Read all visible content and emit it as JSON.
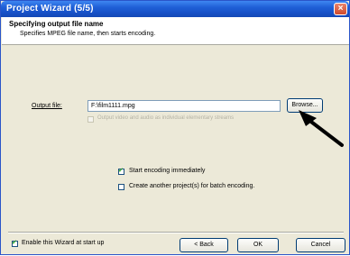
{
  "window": {
    "title": "Project Wizard (5/5)",
    "close_glyph": "×"
  },
  "header": {
    "title": "Specifying output file name",
    "subtitle": "Specifies MPEG file name, then starts encoding."
  },
  "output": {
    "label": "Output file:",
    "value": "F:\\film1111.mpg",
    "browse_label": "Browse...",
    "elementary_label": "Output video and audio as individual elementary streams",
    "elementary_checked": false
  },
  "options": {
    "start_encoding_label": "Start encoding immediately",
    "start_encoding_checked": true,
    "batch_label": "Create another project(s) for batch encoding.",
    "batch_checked": false
  },
  "footer": {
    "enable_wizard_label": "Enable this Wizard at start up",
    "enable_wizard_checked": true,
    "back_label": "< Back",
    "ok_label": "OK",
    "cancel_label": "Cancel"
  },
  "colors": {
    "titlebar": "#1f5fd6",
    "window_bg": "#ece9d8",
    "close": "#cf4a2c"
  },
  "icons": [
    "close-icon",
    "pointer-arrow-icon",
    "checkmark-icon"
  ]
}
